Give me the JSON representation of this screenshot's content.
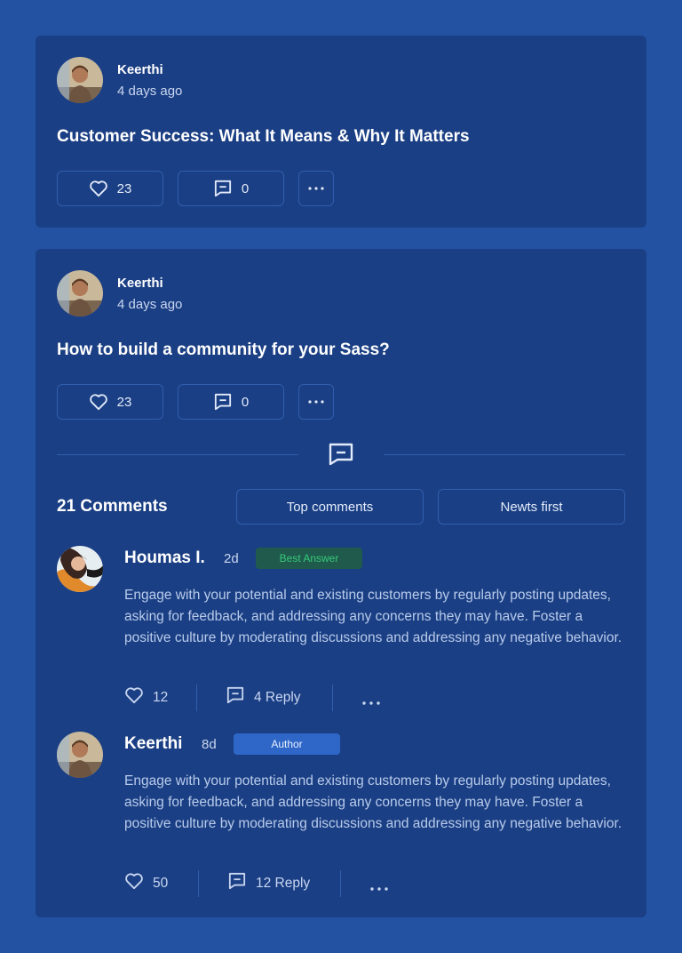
{
  "posts": [
    {
      "author": "Keerthi",
      "time": "4 days ago",
      "title": "Customer Success: What It Means & Why It Matters",
      "likes": "23",
      "comments": "0"
    },
    {
      "author": "Keerthi",
      "time": "4 days ago",
      "title": "How to build a community for your Sass?",
      "likes": "23",
      "comments": "0"
    }
  ],
  "comments_section": {
    "count_label": "21 Comments",
    "sort_top": "Top comments",
    "sort_newest": "Newts first"
  },
  "comments": [
    {
      "author": "Houmas I.",
      "time": "2d",
      "badge": "Best Answer",
      "body": "Engage with your potential and existing customers by regularly posting updates, asking for feedback, and addressing any concerns they may have. Foster a positive culture by moderating discussions and addressing any negative behavior.",
      "likes": "12",
      "replies": "4 Reply"
    },
    {
      "author": "Keerthi",
      "time": "8d",
      "badge": "Author",
      "body": "Engage with your potential and existing customers by regularly posting updates, asking for feedback, and addressing any concerns they may have. Foster a positive culture by moderating discussions and addressing any negative behavior.",
      "likes": "50",
      "replies": "12 Reply"
    }
  ],
  "icons": {
    "like": "heart-icon",
    "comment": "comment-icon",
    "more": "more-horizontal-icon"
  },
  "colors": {
    "page_bg": "#2352a3",
    "card_bg": "#1b3f84",
    "best_answer": "#37c979",
    "author_badge": "#2e67c8"
  }
}
